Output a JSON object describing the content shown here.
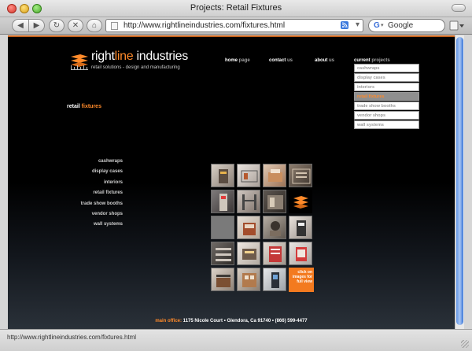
{
  "window": {
    "title": "Projects: Retail Fixtures"
  },
  "browser": {
    "back_icon": "◀",
    "forward_icon": "▶",
    "reload_icon": "↻",
    "stop_icon": "✕",
    "home_icon": "⌂",
    "url": "http://www.rightlineindustries.com/fixtures.html",
    "rss_label": "RSS",
    "search_placeholder": "Google",
    "menu_icon": "▾"
  },
  "site": {
    "brand_plain": "right",
    "brand_highlight": "line",
    "brand_rest": " industries",
    "tagline": "retail solutions - design and manufacturing",
    "brand_color": "#ff8a2a"
  },
  "topnav": [
    {
      "main": "home",
      "sub": " page"
    },
    {
      "main": "contact",
      "sub": " us"
    },
    {
      "main": "about",
      "sub": " us"
    },
    {
      "main": "current",
      "sub": " projects"
    }
  ],
  "dropdown": [
    {
      "label": "cashwraps"
    },
    {
      "label": "display cases"
    },
    {
      "label": "interiors"
    },
    {
      "label": "retail fixtures"
    },
    {
      "label": "trade show booths"
    },
    {
      "label": "vendor shops"
    },
    {
      "label": "wall systems"
    }
  ],
  "section": {
    "title_plain": "retail",
    "title_accent": " fixtures"
  },
  "sidenav": [
    "cashwraps",
    "display cases",
    "interiors",
    "retail fixtures",
    "trade show booths",
    "vendor shops",
    "wall systems"
  ],
  "gallery": {
    "cta_lines": [
      "click on",
      "images for",
      "full view"
    ]
  },
  "footer": {
    "label": "main office:",
    "text": " 1175 Nicole Court • Glendora, Ca 91740 •  (866) 599-4477"
  },
  "status": {
    "text": "http://www.rightlineindustries.com/fixtures.html"
  }
}
